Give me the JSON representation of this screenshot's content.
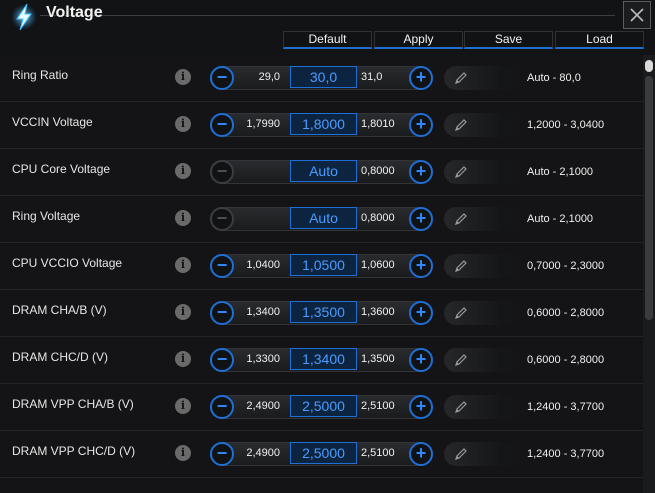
{
  "window": {
    "title": "Voltage"
  },
  "toolbar": {
    "default_label": "Default",
    "apply_label": "Apply",
    "save_label": "Save",
    "load_label": "Load"
  },
  "icons": {
    "title": "lightning-bolt-icon",
    "close": "close-icon",
    "info": "info-icon",
    "edit": "pencil-icon",
    "decrease": "minus-icon",
    "increase": "plus-icon"
  },
  "colors": {
    "accent": "#1e6fd6",
    "current_value_text": "#4a9bff",
    "background": "#141416"
  },
  "rows": [
    {
      "label": "Ring Ratio",
      "low": "29,0",
      "current": "30,0",
      "high": "31,0",
      "range": "Auto - 80,0",
      "minus_enabled": true
    },
    {
      "label": "VCCIN Voltage",
      "low": "1,7990",
      "current": "1,8000",
      "high": "1,8010",
      "range": "1,2000 - 3,0400",
      "minus_enabled": true
    },
    {
      "label": "CPU Core Voltage",
      "low": "",
      "current": "Auto",
      "high": "0,8000",
      "range": "Auto - 2,1000",
      "minus_enabled": false
    },
    {
      "label": "Ring Voltage",
      "low": "",
      "current": "Auto",
      "high": "0,8000",
      "range": "Auto - 2,1000",
      "minus_enabled": false
    },
    {
      "label": "CPU VCCIO Voltage",
      "low": "1,0400",
      "current": "1,0500",
      "high": "1,0600",
      "range": "0,7000 - 2,3000",
      "minus_enabled": true
    },
    {
      "label": "DRAM CHA/B (V)",
      "low": "1,3400",
      "current": "1,3500",
      "high": "1,3600",
      "range": "0,6000 - 2,8000",
      "minus_enabled": true
    },
    {
      "label": "DRAM CHC/D (V)",
      "low": "1,3300",
      "current": "1,3400",
      "high": "1,3500",
      "range": "0,6000 - 2,8000",
      "minus_enabled": true
    },
    {
      "label": "DRAM VPP CHA/B (V)",
      "low": "2,4900",
      "current": "2,5000",
      "high": "2,5100",
      "range": "1,2400 - 3,7700",
      "minus_enabled": true
    },
    {
      "label": "DRAM VPP CHC/D (V)",
      "low": "2,4900",
      "current": "2,5000",
      "high": "2,5100",
      "range": "1,2400 - 3,7700",
      "minus_enabled": true
    }
  ]
}
